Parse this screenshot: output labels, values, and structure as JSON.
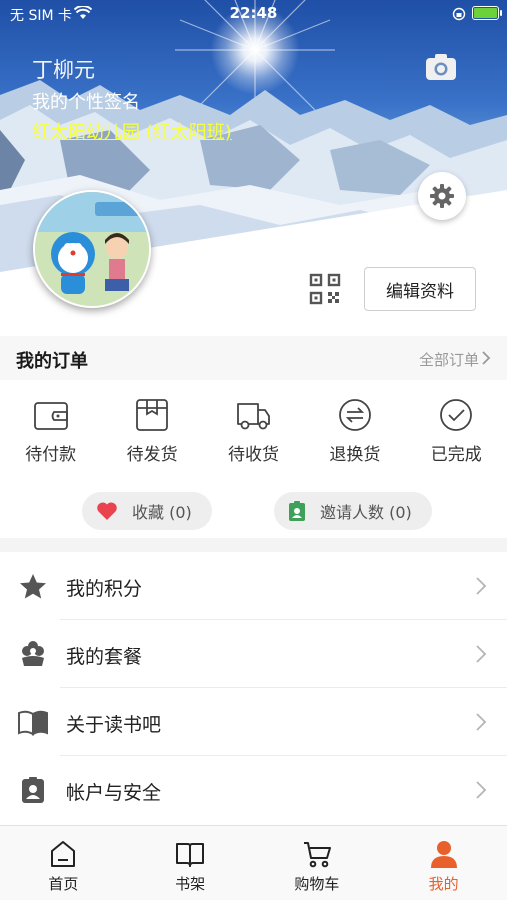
{
  "status_bar": {
    "carrier": "无 SIM 卡",
    "time": "22:48",
    "battery_level": 0.9
  },
  "profile": {
    "name": "丁柳元",
    "signature": "我的个性签名",
    "school": "红太阳幼儿园 (红太阳班)",
    "edit_label": "编辑资料"
  },
  "orders": {
    "title": "我的订单",
    "all_label": "全部订单",
    "items": [
      {
        "label": "待付款",
        "icon": "wallet-icon"
      },
      {
        "label": "待发货",
        "icon": "package-icon"
      },
      {
        "label": "待收货",
        "icon": "truck-icon"
      },
      {
        "label": "退换货",
        "icon": "exchange-icon"
      },
      {
        "label": "已完成",
        "icon": "check-circle-icon"
      }
    ]
  },
  "pills": {
    "favorites": "收藏 (0)",
    "invites": "邀请人数 (0)"
  },
  "menu": [
    {
      "label": "我的积分",
      "icon": "star-icon"
    },
    {
      "label": "我的套餐",
      "icon": "flower-icon"
    },
    {
      "label": "关于读书吧",
      "icon": "book-icon"
    },
    {
      "label": "帐户与安全",
      "icon": "badge-icon"
    }
  ],
  "tabs": [
    {
      "label": "首页",
      "icon": "home-icon",
      "active": false
    },
    {
      "label": "书架",
      "icon": "bookshelf-icon",
      "active": false
    },
    {
      "label": "购物车",
      "icon": "cart-icon",
      "active": false
    },
    {
      "label": "我的",
      "icon": "person-icon",
      "active": true
    }
  ],
  "colors": {
    "accent": "#e8602c",
    "school_link": "#f8ff3a",
    "heart": "#e8434e",
    "invite_green": "#3fa05a"
  }
}
